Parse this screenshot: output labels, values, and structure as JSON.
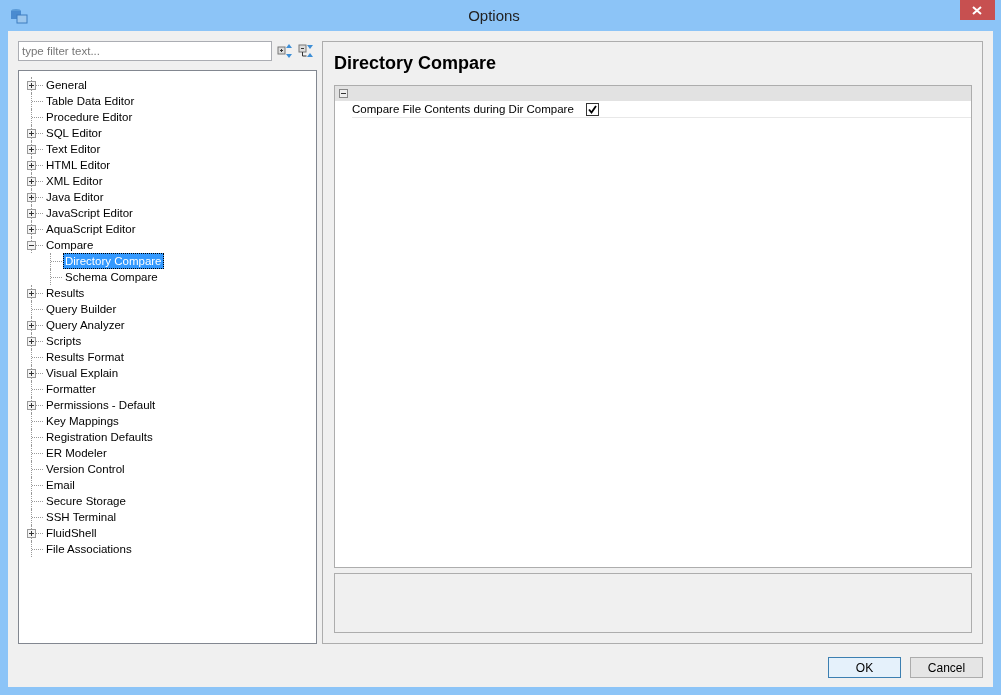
{
  "window": {
    "title": "Options"
  },
  "filter": {
    "placeholder": "type filter text..."
  },
  "tree": [
    {
      "label": "General",
      "expanded": false,
      "selected": false
    },
    {
      "label": "Table Data Editor",
      "selected": false
    },
    {
      "label": "Procedure Editor",
      "selected": false
    },
    {
      "label": "SQL Editor",
      "expanded": false,
      "selected": false
    },
    {
      "label": "Text Editor",
      "expanded": false,
      "selected": false
    },
    {
      "label": "HTML Editor",
      "expanded": false,
      "selected": false
    },
    {
      "label": "XML Editor",
      "expanded": false,
      "selected": false
    },
    {
      "label": "Java Editor",
      "expanded": false,
      "selected": false
    },
    {
      "label": "JavaScript Editor",
      "expanded": false,
      "selected": false
    },
    {
      "label": "AquaScript Editor",
      "expanded": false,
      "selected": false
    },
    {
      "label": "Compare",
      "expanded": true,
      "selected": false,
      "children": [
        {
          "label": "Directory Compare",
          "selected": true
        },
        {
          "label": "Schema Compare",
          "selected": false
        }
      ]
    },
    {
      "label": "Results",
      "expanded": false,
      "selected": false
    },
    {
      "label": "Query Builder",
      "selected": false
    },
    {
      "label": "Query Analyzer",
      "expanded": false,
      "selected": false
    },
    {
      "label": "Scripts",
      "expanded": false,
      "selected": false
    },
    {
      "label": "Results Format",
      "selected": false
    },
    {
      "label": "Visual Explain",
      "expanded": false,
      "selected": false
    },
    {
      "label": "Formatter",
      "selected": false
    },
    {
      "label": "Permissions - Default",
      "expanded": false,
      "selected": false
    },
    {
      "label": "Key Mappings",
      "selected": false
    },
    {
      "label": "Registration Defaults",
      "selected": false
    },
    {
      "label": "ER Modeler",
      "selected": false
    },
    {
      "label": "Version Control",
      "selected": false
    },
    {
      "label": "Email",
      "selected": false
    },
    {
      "label": "Secure Storage",
      "selected": false
    },
    {
      "label": "SSH Terminal",
      "selected": false
    },
    {
      "label": "FluidShell",
      "expanded": false,
      "selected": false
    },
    {
      "label": "File Associations",
      "selected": false
    }
  ],
  "page": {
    "title": "Directory Compare",
    "group_expanded": true,
    "properties": [
      {
        "label": "Compare File Contents during Dir Compare",
        "checked": true
      }
    ]
  },
  "buttons": [
    {
      "label": "OK",
      "default": true
    },
    {
      "label": "Cancel",
      "default": false
    }
  ]
}
